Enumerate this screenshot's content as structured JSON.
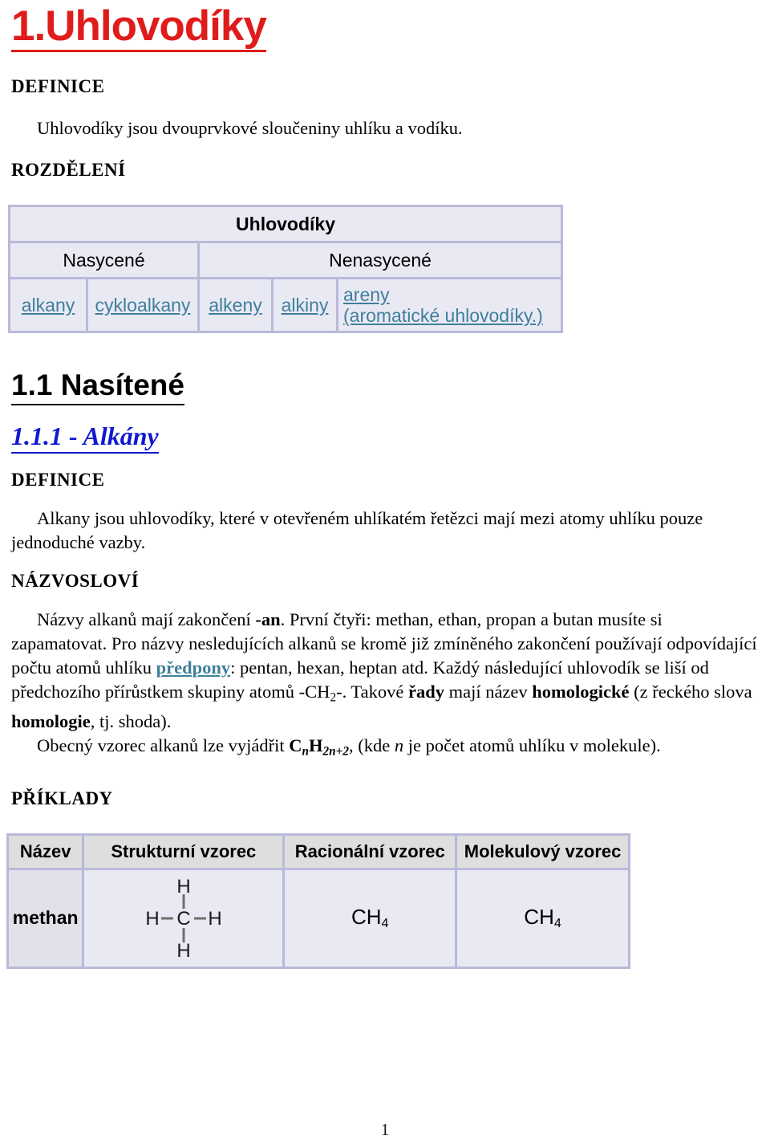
{
  "document": {
    "title": "1.Uhlovodíky",
    "title_color": "#e01b1b",
    "page_number": "1"
  },
  "sections": {
    "definice_label": "DEFINICE",
    "definice_text": "Uhlovodíky jsou dvouprvkové sloučeniny uhlíku a vodíku.",
    "rozdeleni_label": "ROZDĚLENÍ",
    "heading_nasitene": "1.1 Nasítené",
    "heading_alkany": "1.1.1 - Alkány",
    "definice_label_2": "DEFINICE",
    "definice_text_2": "Alkany jsou uhlovodíky, které v otevřeném uhlíkatém řetězci mají mezi atomy uhlíku pouze jednoduché vazby.",
    "nazvoslovi_label": "NÁZVOSLOVÍ",
    "priklady_label": "PŘÍKLADY"
  },
  "nazvoslovi": {
    "p1_a": "Názvy alkanů mají zakončení ",
    "p1_bold1": "-an",
    "p1_b": ". První čtyři: methan, ethan, propan a butan musíte si zapamatovat. Pro názvy nesledujících alkanů se kromě již zmíněného zakončení používají odpovídající počtu atomů uhlíku ",
    "p1_link": "předpony",
    "p1_c": ": pentan, hexan, heptan atd. Každý následující uhlovodík se liší od předchozího přírůstkem skupiny atomů -CH",
    "p1_sub1": "2",
    "p1_d": "-. Takové ",
    "p1_bold2": "řady",
    "p1_e": " mají název ",
    "p1_bold3": "homologické",
    "p1_f": " (z řeckého slova ",
    "p1_bold4": "homologie",
    "p1_g": ", tj. shoda).",
    "p2_a": "Obecný vzorec alkanů lze vyjádřit ",
    "p2_formula_c": "C",
    "p2_formula_n": "n",
    "p2_formula_h": "H",
    "p2_formula_2n2": "2n+2",
    "p2_b": ", (kde ",
    "p2_italic_n": "n",
    "p2_c": " je počet atomů uhlíku v molekule)."
  },
  "classification_table": {
    "root": "Uhlovodíky",
    "groups": [
      {
        "label": "Nasycené",
        "span": 2
      },
      {
        "label": "Nenasycené",
        "span": 3
      }
    ],
    "leaves": [
      {
        "label": "alkany",
        "is_link": true
      },
      {
        "label": "cykloalkany",
        "is_link": true
      },
      {
        "label": "alkeny",
        "is_link": true
      },
      {
        "label": "alkiny",
        "is_link": true
      },
      {
        "label_line1": "areny",
        "label_line2": "(aromatické uhlovodíky.)",
        "is_link": true
      }
    ]
  },
  "examples_table": {
    "headers": [
      "Název",
      "Strukturní vzorec",
      "Racionální vzorec",
      "Molekulový vzorec"
    ],
    "rows": [
      {
        "name": "methan",
        "structural": {
          "center_atom": "C",
          "bonded_atoms": [
            "H",
            "H",
            "H",
            "H"
          ],
          "bond_color": "#6f6f6f"
        },
        "rational_main": "CH",
        "rational_sub": "4",
        "molecular_main": "CH",
        "molecular_sub": "4"
      }
    ]
  },
  "colors": {
    "title_red": "#e01b1b",
    "link_blue": "#3f7f9b",
    "heading_blue": "#1018d0",
    "table_border": "#b9b9d9",
    "table_cell": "#e9e9f4",
    "table_header_cell": "#dededf"
  }
}
